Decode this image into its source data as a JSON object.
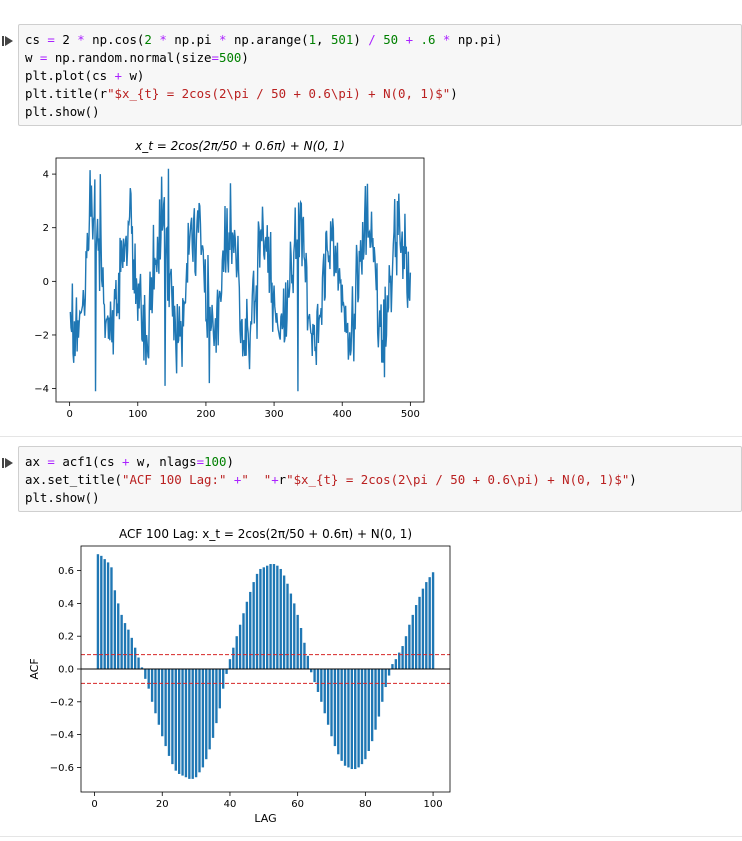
{
  "cells": [
    {
      "code_lines": [
        [
          [
            "cs ",
            ""
          ],
          [
            "=",
            "op"
          ],
          [
            " 2 ",
            ""
          ],
          [
            "*",
            "op"
          ],
          [
            " np.cos(",
            ""
          ],
          [
            "2",
            "num"
          ],
          [
            " ",
            ""
          ],
          [
            "*",
            "op"
          ],
          [
            " np.pi ",
            ""
          ],
          [
            "*",
            "op"
          ],
          [
            " np.arange(",
            ""
          ],
          [
            "1",
            "num"
          ],
          [
            ", ",
            ""
          ],
          [
            "501",
            "num"
          ],
          [
            ") ",
            ""
          ],
          [
            "/",
            "op"
          ],
          [
            " ",
            ""
          ],
          [
            "50",
            "num"
          ],
          [
            " ",
            ""
          ],
          [
            "+",
            "op"
          ],
          [
            " ",
            ""
          ],
          [
            ".6",
            "num"
          ],
          [
            " ",
            ""
          ],
          [
            "*",
            "op"
          ],
          [
            " np.pi)",
            ""
          ]
        ],
        [
          [
            "w ",
            ""
          ],
          [
            "=",
            "op"
          ],
          [
            " np.random.normal(size",
            ""
          ],
          [
            "=",
            "op"
          ],
          [
            "500",
            "num"
          ],
          [
            ")",
            ""
          ]
        ],
        [
          [
            "plt.plot(cs ",
            ""
          ],
          [
            "+",
            "op"
          ],
          [
            " w)",
            ""
          ]
        ],
        [
          [
            "plt.title(r",
            ""
          ],
          [
            "\"$x_{t} = 2cos(2\\pi / 50 + 0.6\\pi) + N(0, 1)$\"",
            "str"
          ],
          [
            ")",
            ""
          ]
        ],
        [
          [
            "plt.show()",
            ""
          ]
        ]
      ]
    },
    {
      "code_lines": [
        [
          [
            "ax ",
            ""
          ],
          [
            "=",
            "op"
          ],
          [
            " acf1(cs ",
            ""
          ],
          [
            "+",
            "op"
          ],
          [
            " w, nlags",
            ""
          ],
          [
            "=",
            "op"
          ],
          [
            "100",
            "num"
          ],
          [
            ")",
            ""
          ]
        ],
        [
          [
            "ax.set_title(",
            ""
          ],
          [
            "\"ACF 100 Lag:\" ",
            "str"
          ],
          [
            "+",
            "op"
          ],
          [
            "\"  \"",
            "str"
          ],
          [
            "+",
            "op"
          ],
          [
            "r",
            ""
          ],
          [
            "\"$x_{t} = 2cos(2\\pi / 50 + 0.6\\pi) + N(0, 1)$\"",
            "str"
          ],
          [
            ")",
            ""
          ]
        ],
        [
          [
            "plt.show()",
            ""
          ]
        ]
      ]
    }
  ],
  "colors": {
    "series": "#1f77b4",
    "conf_band": "#d62728",
    "axis": "#000000"
  },
  "chart_data": [
    {
      "type": "line",
      "title": "x_t = 2cos(2π/50 + 0.6π) + N(0, 1)",
      "xlim": [
        -20,
        520
      ],
      "ylim": [
        -4.5,
        4.6
      ],
      "xticks": [
        0,
        100,
        200,
        300,
        400,
        500
      ],
      "yticks": [
        -4,
        -2,
        0,
        2,
        4
      ],
      "ytick_labels": [
        "−4",
        "−2",
        "0",
        "2",
        "4"
      ],
      "series": [
        {
          "x": [
            1,
            500
          ],
          "y_formula": "2*cos(2*pi*t/50 + 0.6*pi) + noise"
        }
      ],
      "extremes": [
        {
          "x": 38,
          "y": -4.1
        },
        {
          "x": 45,
          "y": 4.0
        },
        {
          "x": 140,
          "y": -3.9
        },
        {
          "x": 145,
          "y": 4.2
        },
        {
          "x": 335,
          "y": -4.1
        },
        {
          "x": 340,
          "y": 2.9
        }
      ],
      "grid": false
    },
    {
      "type": "bar",
      "title": "ACF 100 Lag:  x_t = 2cos(2π/50 + 0.6π) + N(0, 1)",
      "xlabel": "LAG",
      "ylabel": "ACF",
      "xlim": [
        -4,
        105
      ],
      "ylim": [
        -0.75,
        0.75
      ],
      "xticks": [
        0,
        20,
        40,
        60,
        80,
        100
      ],
      "yticks": [
        -0.6,
        -0.4,
        -0.2,
        0.0,
        0.2,
        0.4,
        0.6
      ],
      "ytick_labels": [
        "−0.6",
        "−0.4",
        "−0.2",
        "0.0",
        "0.2",
        "0.4",
        "0.6"
      ],
      "lags": [
        1,
        100
      ],
      "conf_band": 0.088,
      "values": [
        0.7,
        0.69,
        0.67,
        0.65,
        0.62,
        0.48,
        0.4,
        0.33,
        0.28,
        0.24,
        0.19,
        0.13,
        0.07,
        0.01,
        -0.06,
        -0.12,
        -0.2,
        -0.27,
        -0.34,
        -0.41,
        -0.47,
        -0.53,
        -0.58,
        -0.62,
        -0.64,
        -0.65,
        -0.66,
        -0.67,
        -0.67,
        -0.66,
        -0.63,
        -0.6,
        -0.55,
        -0.49,
        -0.42,
        -0.33,
        -0.24,
        -0.12,
        -0.03,
        0.06,
        0.13,
        0.2,
        0.27,
        0.34,
        0.41,
        0.47,
        0.53,
        0.58,
        0.61,
        0.62,
        0.63,
        0.64,
        0.64,
        0.63,
        0.61,
        0.57,
        0.52,
        0.46,
        0.4,
        0.33,
        0.25,
        0.16,
        0.08,
        -0.02,
        -0.08,
        -0.14,
        -0.2,
        -0.27,
        -0.34,
        -0.41,
        -0.47,
        -0.52,
        -0.56,
        -0.59,
        -0.6,
        -0.61,
        -0.61,
        -0.6,
        -0.58,
        -0.55,
        -0.5,
        -0.44,
        -0.37,
        -0.29,
        -0.2,
        -0.11,
        -0.04,
        0.03,
        0.06,
        0.1,
        0.14,
        0.2,
        0.27,
        0.33,
        0.39,
        0.44,
        0.49,
        0.53,
        0.56,
        0.59
      ],
      "grid": false
    }
  ]
}
